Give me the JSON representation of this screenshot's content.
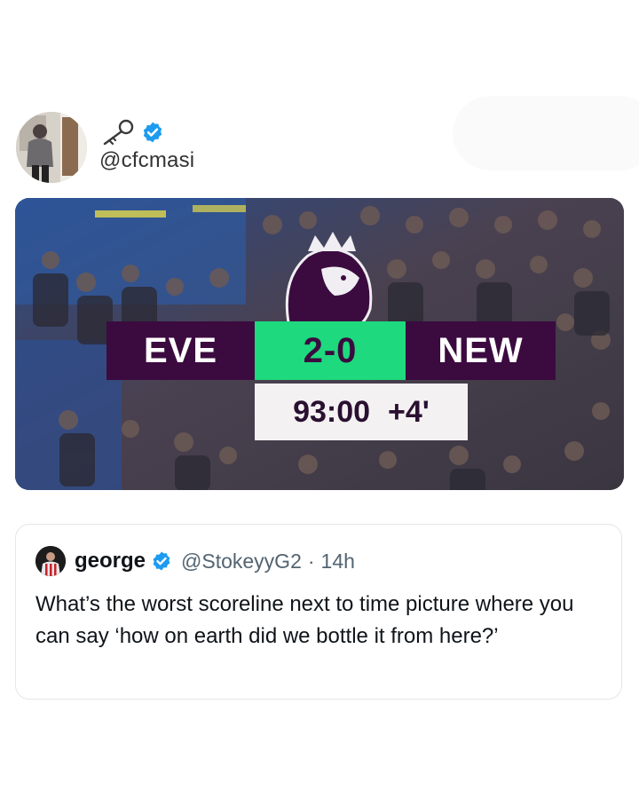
{
  "post": {
    "author_name_icon": "key-icon",
    "verified": true,
    "handle": "@cfcmasi"
  },
  "media": {
    "scoreboard": {
      "home_team": "EVE",
      "score": "2-0",
      "away_team": "NEW",
      "clock": "93:00",
      "added_time": "+4'"
    },
    "colors": {
      "team_panel": "#3b0b3f",
      "score_panel": "#1ed97d",
      "clock_panel": "#f4f1f2"
    }
  },
  "quoted_tweet": {
    "name": "george",
    "verified": true,
    "handle": "@StokeyyG2",
    "separator": "·",
    "time": "14h",
    "text": "What’s the worst scoreline next to time picture where you can say ‘how on earth did we bottle it from here?’"
  },
  "colors": {
    "verified_badge": "#1d9bf0",
    "secondary_text": "#536471"
  }
}
